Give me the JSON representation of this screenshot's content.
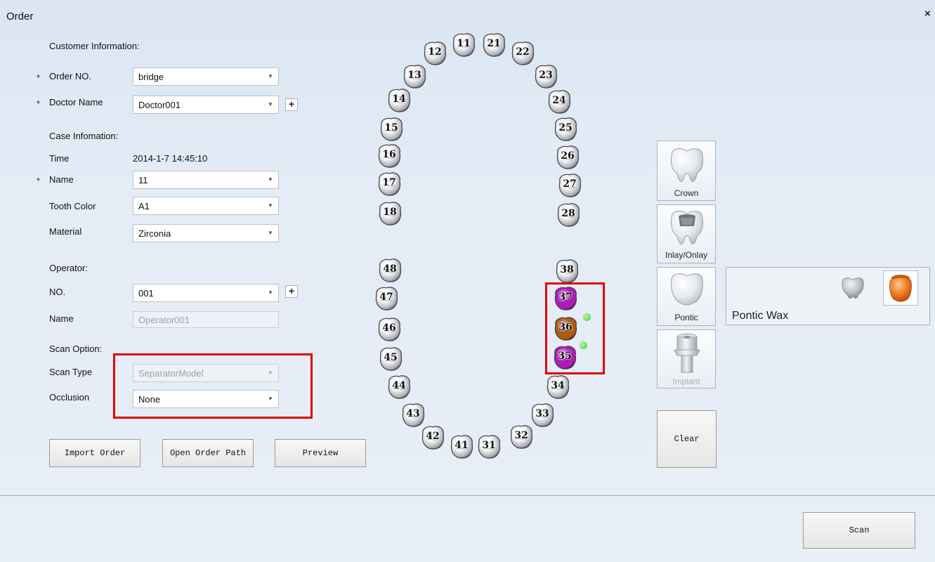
{
  "window": {
    "title": "Order",
    "close": "×"
  },
  "customer": {
    "header": "Customer Information:",
    "order_no": {
      "star": "*",
      "label": "Order NO.",
      "value": "bridge"
    },
    "doctor": {
      "star": "*",
      "label": "Doctor Name",
      "value": "Doctor001",
      "add": "+"
    }
  },
  "case": {
    "header": "Case Infomation:",
    "time": {
      "label": "Time",
      "value": "2014-1-7 14:45:10"
    },
    "name": {
      "star": "*",
      "label": "Name",
      "value": "11"
    },
    "tooth_color": {
      "label": "Tooth Color",
      "value": "A1"
    },
    "material": {
      "label": "Material",
      "value": "Zirconia"
    }
  },
  "operator": {
    "header": "Operator:",
    "no": {
      "label": "NO.",
      "value": "001",
      "add": "+"
    },
    "name": {
      "label": "Name",
      "value": "Operator001"
    }
  },
  "scan": {
    "header": "Scan Option:",
    "type": {
      "label": "Scan Type",
      "value": "SeparatorModel"
    },
    "occlusion": {
      "label": "Occlusion",
      "value": "None"
    }
  },
  "buttons": {
    "import": "Import Order",
    "open_path": "Open Order Path",
    "preview": "Preview",
    "clear": "Clear",
    "scan": "Scan"
  },
  "teeth": {
    "upper": [
      "11",
      "12",
      "13",
      "14",
      "15",
      "16",
      "17",
      "18",
      "21",
      "22",
      "23",
      "24",
      "25",
      "26",
      "27",
      "28"
    ],
    "lower": [
      "31",
      "32",
      "33",
      "34",
      "35",
      "36",
      "37",
      "38",
      "41",
      "42",
      "43",
      "44",
      "45",
      "46",
      "47",
      "48"
    ],
    "selected": [
      {
        "id": "37",
        "color": "#b01ab8"
      },
      {
        "id": "36",
        "color": "#b05a10"
      },
      {
        "id": "35",
        "color": "#b01ab8"
      }
    ]
  },
  "tooth_types": [
    {
      "label": "Crown",
      "icon": "crown-icon",
      "enabled": true
    },
    {
      "label": "Inlay/Onlay",
      "icon": "inlay-onlay-icon",
      "enabled": true
    },
    {
      "label": "Pontic",
      "icon": "pontic-icon",
      "enabled": true
    },
    {
      "label": "Implant",
      "icon": "implant-icon",
      "enabled": false
    }
  ],
  "material_panel": {
    "label": "Pontic Wax",
    "icons": [
      "metal-crown-icon",
      "wax-crown-icon"
    ]
  },
  "colors": {
    "accent_red": "#e00000",
    "purple": "#b01ab8",
    "orange": "#b05a10",
    "connector_green": "#3ccf3c"
  }
}
